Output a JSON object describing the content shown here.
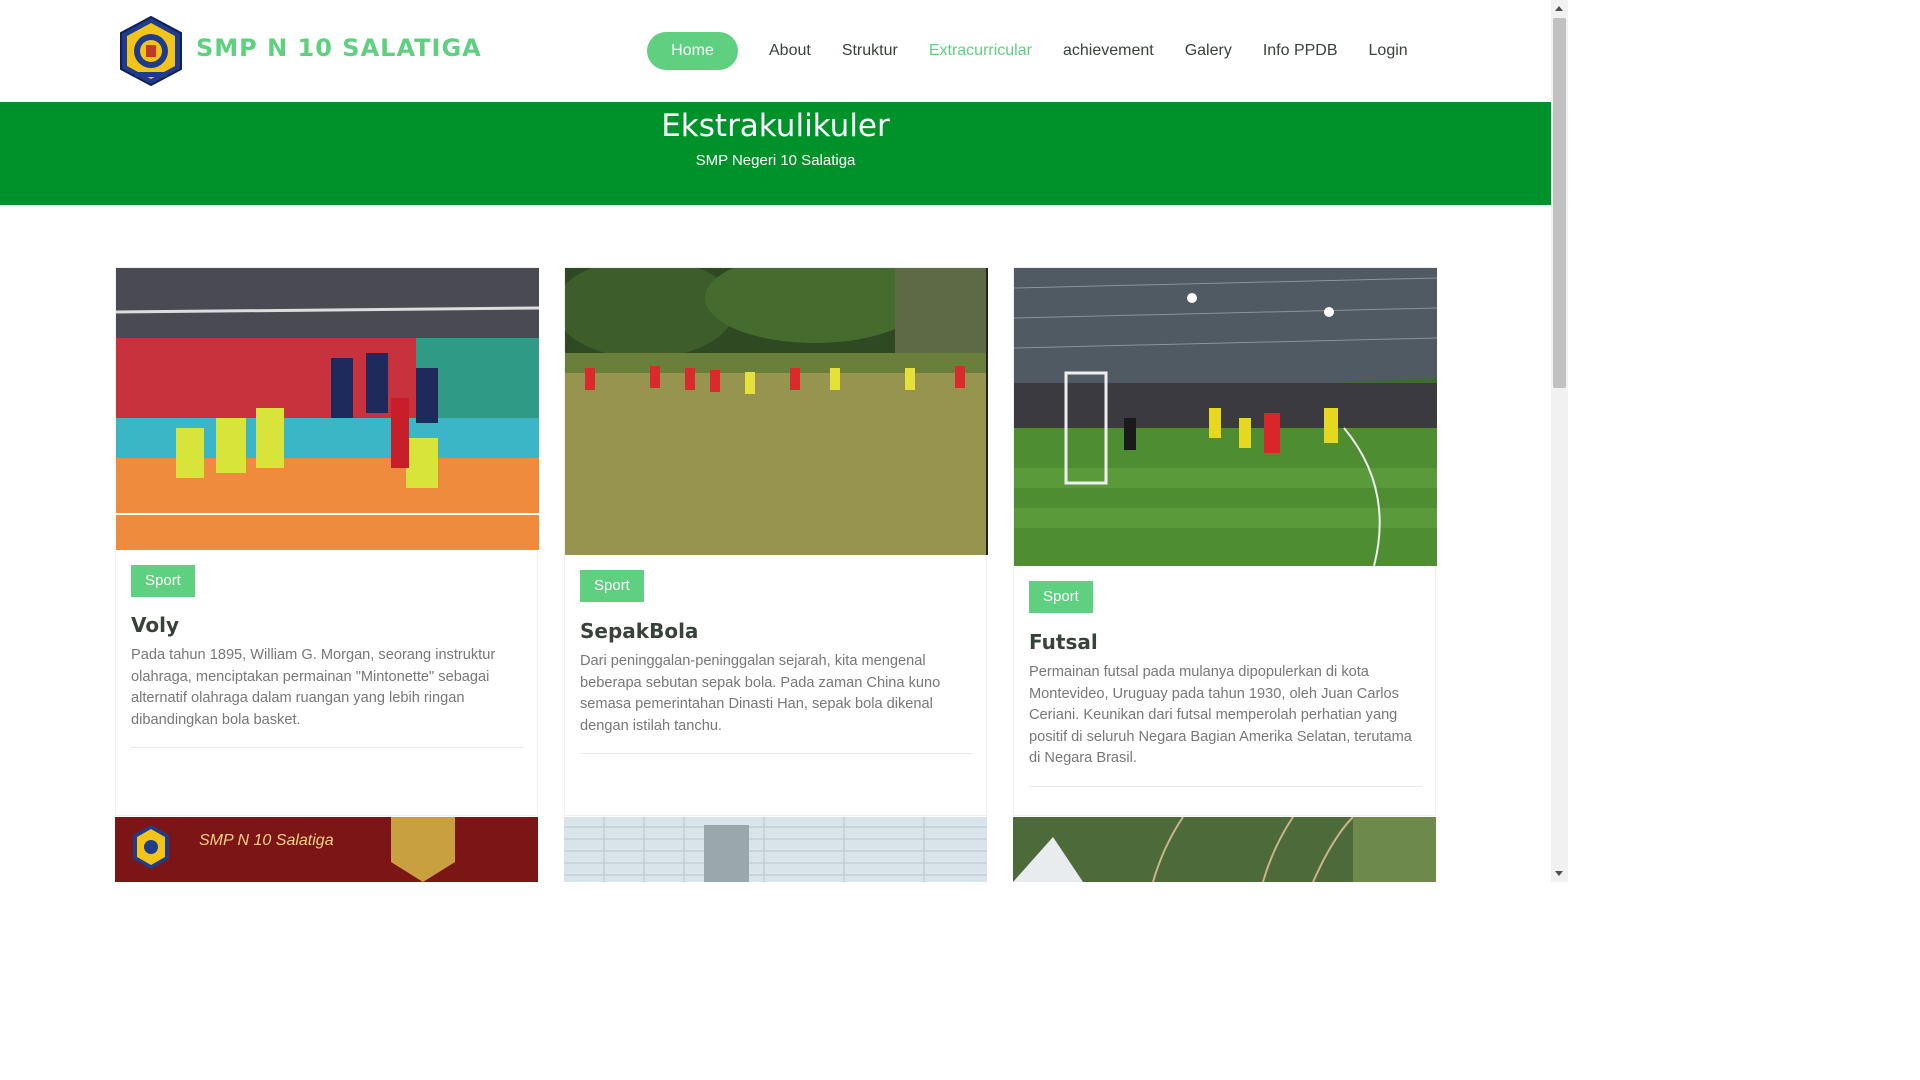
{
  "brand": {
    "name": "SMP N 10 SALATIGA"
  },
  "nav": {
    "items": [
      {
        "label": "Home"
      },
      {
        "label": "About"
      },
      {
        "label": "Struktur"
      },
      {
        "label": "Extracurricular"
      },
      {
        "label": "achievement"
      },
      {
        "label": "Galery"
      },
      {
        "label": "Info PPDB"
      },
      {
        "label": "Login"
      }
    ]
  },
  "banner": {
    "title": "Ekstrakulikuler",
    "subtitle": "SMP Negeri 10 Salatiga"
  },
  "cards": [
    {
      "category": "Sport",
      "title": "Voly",
      "description": "Pada tahun 1895, William G. Morgan, seorang instruktur olahraga, menciptakan permainan \"Mintonette\" sebagai alternatif olahraga dalam ruangan yang lebih ringan dibandingkan bola basket."
    },
    {
      "category": "Sport",
      "title": "SepakBola",
      "description": "Dari peninggalan-peninggalan sejarah, kita mengenal beberapa sebutan sepak bola. Pada zaman China kuno semasa pemerintahan Dinasti Han, sepak bola dikenal dengan istilah tanchu."
    },
    {
      "category": "Sport",
      "title": "Futsal",
      "description": "Permainan futsal pada mulanya dipopulerkan di kota Montevideo, Uruguay pada tahun 1930, oleh Juan Carlos Ceriani. Keunikan dari futsal memperolah perhatian yang positif di seluruh Negara Bagian Amerika Selatan, terutama di Negara Brasil."
    }
  ],
  "bottom_cards": [
    {
      "caption": "SMP N 10 Salatiga"
    }
  ],
  "colors": {
    "accent": "#5fcf80",
    "banner": "#00922a",
    "text": "#37423b",
    "muted": "#777777"
  }
}
